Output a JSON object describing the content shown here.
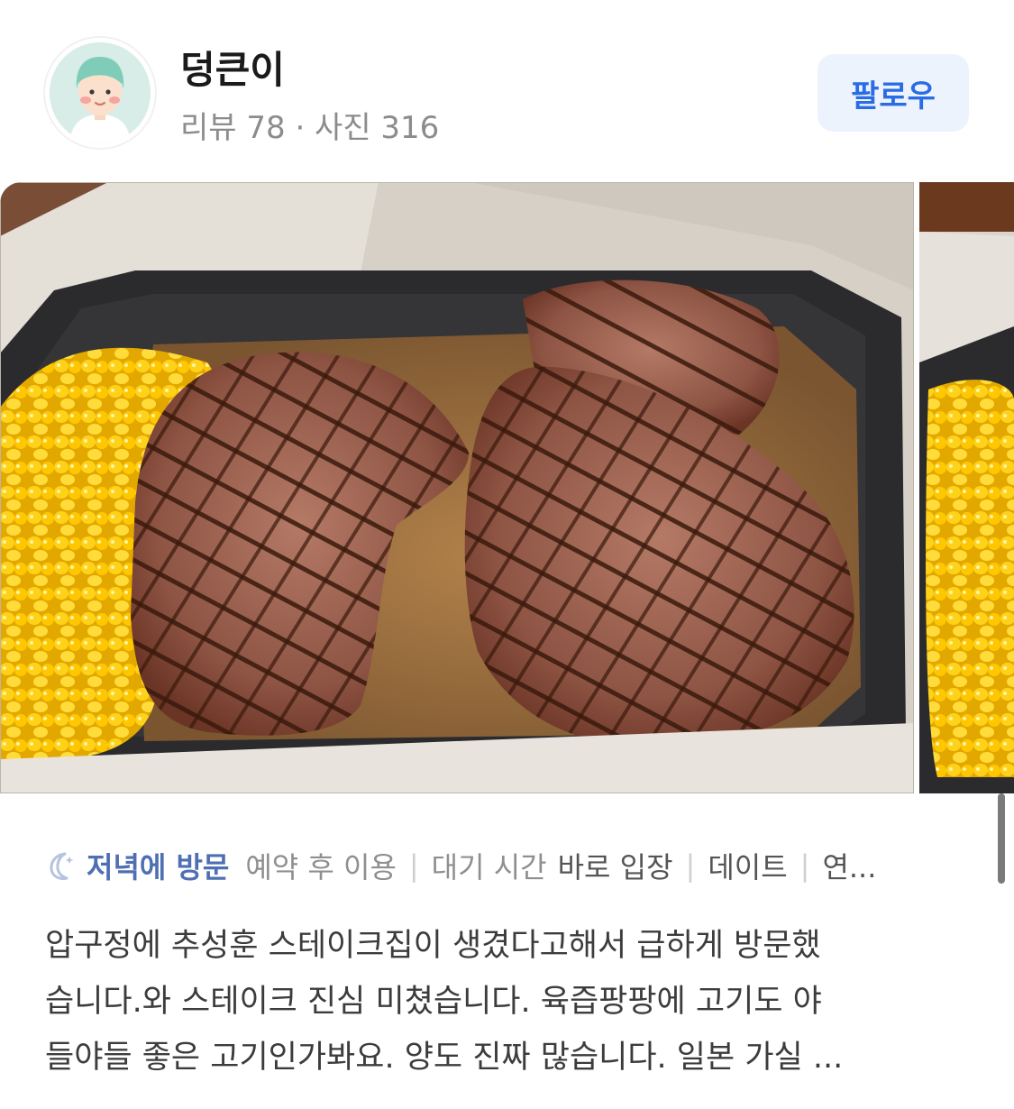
{
  "user": {
    "name": "덩큰이",
    "stats": "리뷰 78 · 사진 316"
  },
  "follow_label": "팔로우",
  "visit_info": {
    "visit_time": "저녁에 방문",
    "items": [
      {
        "label": "예약 후 이용",
        "value": ""
      },
      {
        "label": "대기 시간",
        "value": "바로 입장"
      },
      {
        "label": "데이트",
        "value": ""
      },
      {
        "label": "연...",
        "value": ""
      }
    ]
  },
  "review": {
    "lines": [
      "압구정에 추성훈 스테이크집이 생겼다고해서 급하게 방문했",
      "습니다.와 스테이크 진심 미쳤습니다. 육즙팡팡에 고기도 야",
      "들야들 좋은 고기인가봐요. 양도 진짜 많습니다. 일본 가실 ..."
    ]
  },
  "colors": {
    "accent": "#2a6ce3",
    "follow_bg": "#edf3fc",
    "visit_tag": "#4f6fb3"
  },
  "icons": [
    "moon-icon"
  ]
}
